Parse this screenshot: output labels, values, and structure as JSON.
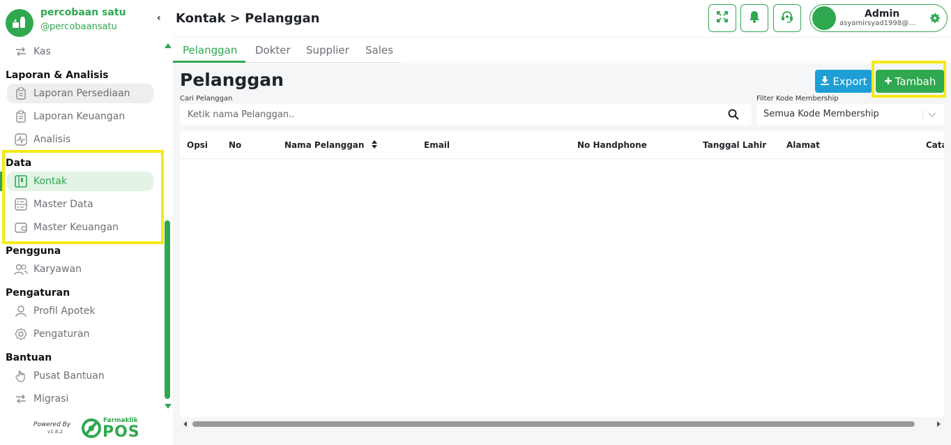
{
  "brand": {
    "name": "percobaan satu",
    "handle": "@percobaansatu"
  },
  "sidebar": {
    "items_top": [
      {
        "label": "Kas",
        "icon": "transfer-icon"
      }
    ],
    "sections": [
      {
        "title": "Laporan & Analisis",
        "items": [
          {
            "label": "Laporan Persediaan"
          },
          {
            "label": "Laporan Keuangan"
          },
          {
            "label": "Analisis"
          }
        ]
      },
      {
        "title": "Data",
        "items": [
          {
            "label": "Kontak"
          },
          {
            "label": "Master Data"
          },
          {
            "label": "Master Keuangan"
          }
        ]
      },
      {
        "title": "Pengguna",
        "items": [
          {
            "label": "Karyawan"
          }
        ]
      },
      {
        "title": "Pengaturan",
        "items": [
          {
            "label": "Profil Apotek"
          },
          {
            "label": "Pengaturan"
          }
        ]
      },
      {
        "title": "Bantuan",
        "items": [
          {
            "label": "Pusat Bantuan"
          },
          {
            "label": "Migrasi"
          }
        ]
      }
    ],
    "powered_by": "Powered By",
    "version": "v1.8.2",
    "product_small": "Farmaklik",
    "product_big": "POS"
  },
  "header": {
    "breadcrumb": "Kontak > Pelanggan",
    "user": {
      "name": "Admin",
      "email": "asyamirsyad1998@g..."
    }
  },
  "tabs": [
    "Pelanggan",
    "Dokter",
    "Supplier",
    "Sales"
  ],
  "page": {
    "title": "Pelanggan",
    "export_label": "Export",
    "add_label": "Tambah",
    "search_label": "Cari Pelanggan",
    "search_placeholder": "Ketik nama Pelanggan..",
    "filter_label": "Filter Kode Membership",
    "filter_value": "Semua Kode Membership"
  },
  "table": {
    "columns": [
      "Opsi",
      "No",
      "Nama Pelanggan",
      "Email",
      "No Handphone",
      "Tanggal Lahir",
      "Alamat",
      "Cata"
    ]
  },
  "colors": {
    "accent": "#2fa84f",
    "export": "#1d9fd6",
    "highlight": "#f5ea16"
  }
}
